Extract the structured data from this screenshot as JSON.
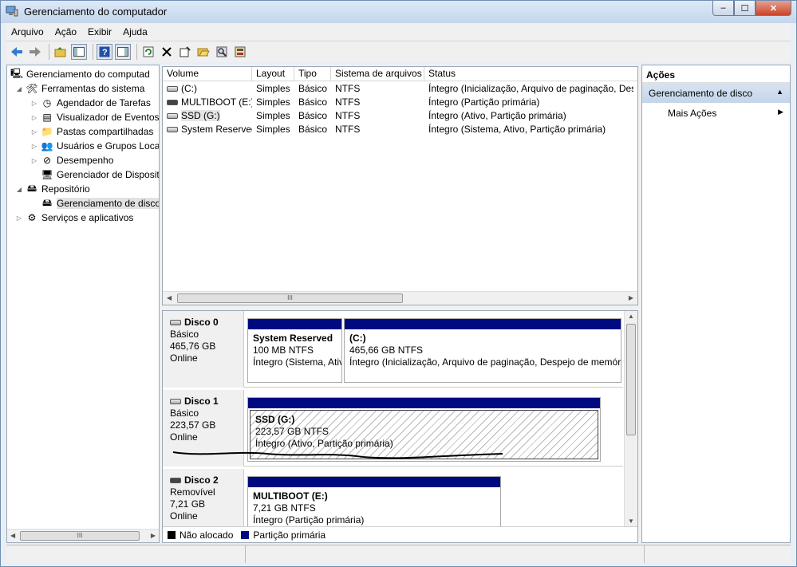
{
  "window": {
    "title": "Gerenciamento do computador",
    "min": "‒",
    "max": "☐",
    "close": "✕"
  },
  "menu": [
    "Arquivo",
    "Ação",
    "Exibir",
    "Ajuda"
  ],
  "tree": {
    "items": [
      {
        "label": "Gerenciamento do computad",
        "icon": "computer-icon",
        "level": 0,
        "exp": "",
        "sel": false
      },
      {
        "label": "Ferramentas do sistema",
        "icon": "tools-icon",
        "level": 1,
        "exp": "◢",
        "sel": false
      },
      {
        "label": "Agendador de Tarefas",
        "icon": "clock-icon",
        "level": 2,
        "exp": "▷",
        "sel": false
      },
      {
        "label": "Visualizador de Eventos",
        "icon": "event-viewer-icon",
        "level": 2,
        "exp": "▷",
        "sel": false
      },
      {
        "label": "Pastas compartilhadas",
        "icon": "shared-folder-icon",
        "level": 2,
        "exp": "▷",
        "sel": false
      },
      {
        "label": "Usuários e Grupos Loca",
        "icon": "users-icon",
        "level": 2,
        "exp": "▷",
        "sel": false
      },
      {
        "label": "Desempenho",
        "icon": "performance-icon",
        "level": 2,
        "exp": "▷",
        "sel": false
      },
      {
        "label": "Gerenciador de Disposit",
        "icon": "device-manager-icon",
        "level": 2,
        "exp": "",
        "sel": false
      },
      {
        "label": "Repositório",
        "icon": "storage-icon",
        "level": 1,
        "exp": "◢",
        "sel": false
      },
      {
        "label": "Gerenciamento de disco",
        "icon": "disk-management-icon",
        "level": 2,
        "exp": "",
        "sel": true
      },
      {
        "label": "Serviços e aplicativos",
        "icon": "services-icon",
        "level": 1,
        "exp": "▷",
        "sel": false
      }
    ]
  },
  "volumes": {
    "headers": [
      "Volume",
      "Layout",
      "Tipo",
      "Sistema de arquivos",
      "Status"
    ],
    "rows": [
      {
        "volume": "(C:)",
        "layout": "Simples",
        "tipo": "Básico",
        "fs": "NTFS",
        "status": "Íntegro (Inicialização, Arquivo de paginação, Despejo de memória, Partição primária)"
      },
      {
        "volume": "MULTIBOOT (E:)",
        "layout": "Simples",
        "tipo": "Básico",
        "fs": "NTFS",
        "status": "Íntegro (Partição primária)"
      },
      {
        "volume": "SSD (G:)",
        "layout": "Simples",
        "tipo": "Básico",
        "fs": "NTFS",
        "status": "Íntegro (Ativo, Partição primária)"
      },
      {
        "volume": "System Reserved",
        "layout": "Simples",
        "tipo": "Básico",
        "fs": "NTFS",
        "status": "Íntegro (Sistema, Ativo, Partição primária)"
      }
    ]
  },
  "disks": [
    {
      "name": "Disco 0",
      "type": "Básico",
      "size": "465,76 GB",
      "state": "Online",
      "partitions": [
        {
          "name": "System Reserved",
          "size": "100 MB NTFS",
          "status": "Íntegro (Sistema, Ativo, Partição primária)"
        },
        {
          "name": "(C:)",
          "size": "465,66 GB NTFS",
          "status": "Íntegro (Inicialização, Arquivo de paginação, Despejo de memória, Partição primária)"
        }
      ]
    },
    {
      "name": "Disco 1",
      "type": "Básico",
      "size": "223,57 GB",
      "state": "Online",
      "partitions": [
        {
          "name": "SSD  (G:)",
          "size": "223,57 GB NTFS",
          "status": "Íntegro (Ativo, Partição primária)"
        }
      ]
    },
    {
      "name": "Disco 2",
      "type": "Removível",
      "size": "7,21 GB",
      "state": "Online",
      "partitions": [
        {
          "name": "MULTIBOOT  (E:)",
          "size": "7,21 GB NTFS",
          "status": "Íntegro (Partição primária)"
        }
      ]
    }
  ],
  "legend": [
    {
      "label": "Não alocado",
      "color": "#000000"
    },
    {
      "label": "Partição primária",
      "color": "#000a80"
    }
  ],
  "actions": {
    "title": "Ações",
    "section": "Gerenciamento de disco",
    "more": "Mais Ações"
  },
  "scroll_glyph": "III"
}
